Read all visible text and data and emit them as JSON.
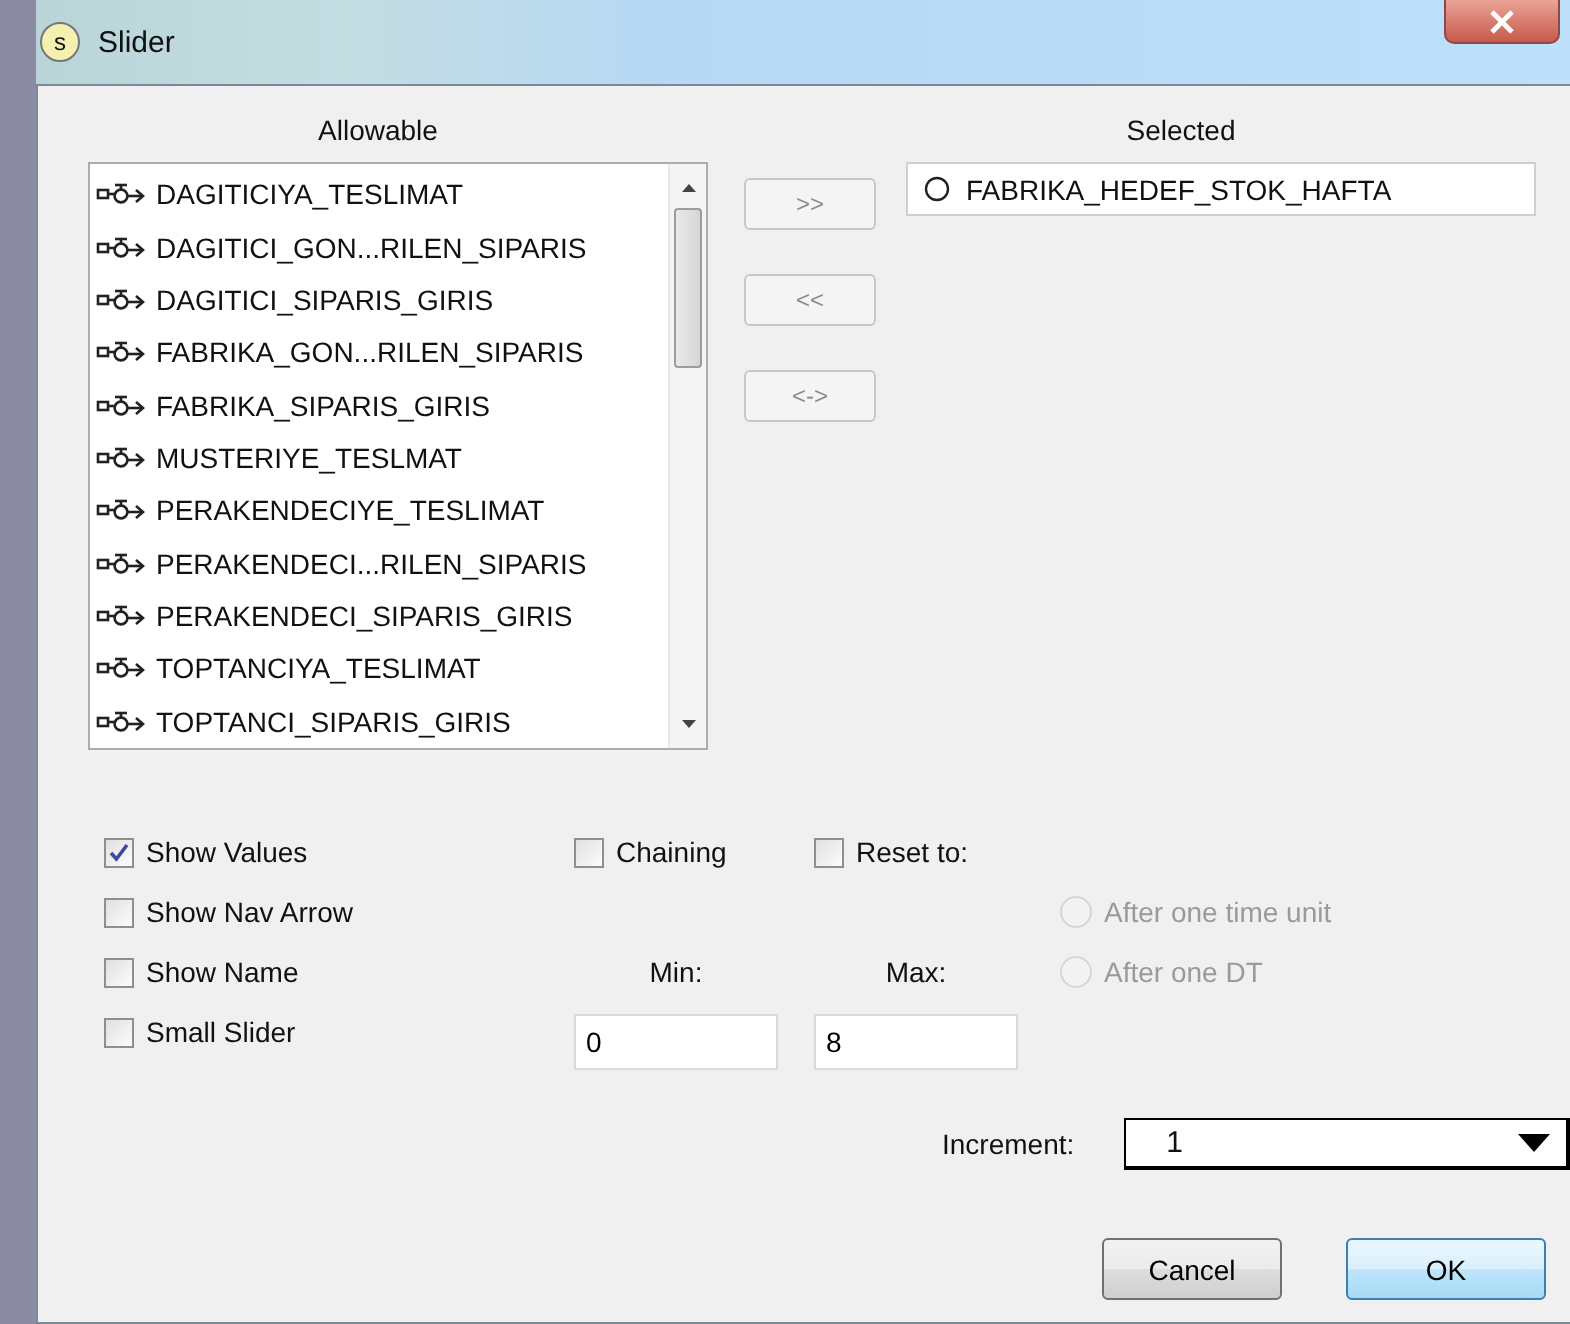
{
  "window": {
    "icon_letter": "s",
    "title": "Slider"
  },
  "allowable": {
    "label": "Allowable",
    "items": [
      {
        "text": "DAGITICIYA_TESLIMAT"
      },
      {
        "text": "DAGITICI_GON...RILEN_SIPARIS"
      },
      {
        "text": "DAGITICI_SIPARIS_GIRIS"
      },
      {
        "text": "FABRIKA_GON...RILEN_SIPARIS"
      },
      {
        "text": "FABRIKA_SIPARIS_GIRIS"
      },
      {
        "text": "MUSTERIYE_TESLMAT"
      },
      {
        "text": "PERAKENDECIYE_TESLIMAT"
      },
      {
        "text": "PERAKENDECI...RILEN_SIPARIS"
      },
      {
        "text": "PERAKENDECI_SIPARIS_GIRIS"
      },
      {
        "text": "TOPTANCIYA_TESLIMAT"
      },
      {
        "text": "TOPTANCI_SIPARIS_GIRIS"
      }
    ]
  },
  "move_buttons": [
    ">>",
    "<<",
    "<->"
  ],
  "selected": {
    "label": "Selected",
    "items": [
      {
        "text": "FABRIKA_HEDEF_STOK_HAFTA"
      }
    ]
  },
  "options": [
    {
      "label": "Show Values",
      "checked": true
    },
    {
      "label": "Show Nav Arrow",
      "checked": false
    },
    {
      "label": "Show Name",
      "checked": false
    },
    {
      "label": "Small Slider",
      "checked": false
    }
  ],
  "chaining": {
    "label": "Chaining",
    "checked": false
  },
  "reset_to": {
    "label": "Reset to:",
    "checked": false,
    "choices": [
      {
        "label": "After one time unit",
        "selected": false,
        "disabled": true
      },
      {
        "label": "After one DT",
        "selected": false,
        "disabled": true
      }
    ]
  },
  "min": {
    "label": "Min:",
    "value": "0"
  },
  "max": {
    "label": "Max:",
    "value": "8"
  },
  "increment": {
    "label": "Increment:",
    "value": "1"
  },
  "buttons": [
    {
      "label": "Cancel",
      "default": false
    },
    {
      "label": "OK",
      "default": true
    }
  ]
}
